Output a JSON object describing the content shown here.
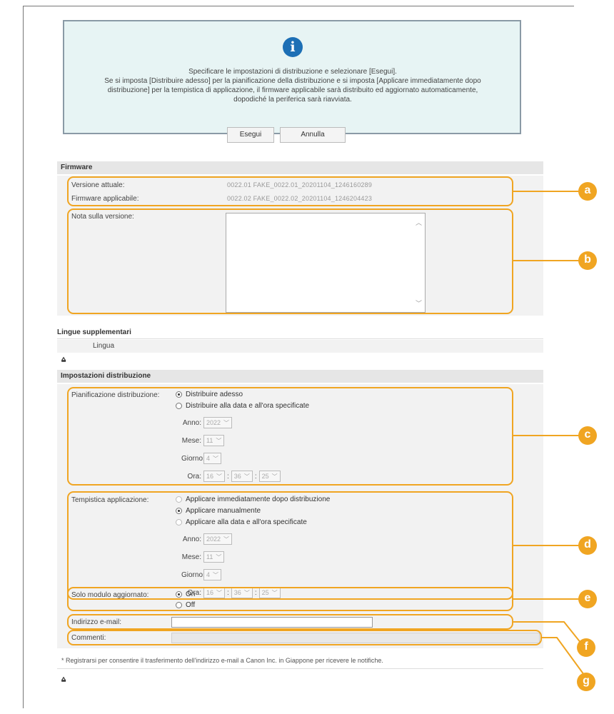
{
  "dialog": {
    "icon": "info-icon",
    "message_line1": "Specificare le impostazioni di distribuzione e selezionare [Esegui].",
    "message_line2": "Se si imposta [Distribuire adesso] per la pianificazione della distribuzione e si imposta [Applicare immediatamente dopo distribuzione] per la tempistica di applicazione, il firmware applicabile sarà distribuito ed aggiornato automaticamente, dopodiché la periferica sarà riavviata.",
    "execute_label": "Esegui",
    "cancel_label": "Annulla"
  },
  "firmware": {
    "heading": "Firmware",
    "current_version_label": "Versione attuale:",
    "current_version_value": "0022.01 FAKE_0022.01_20201104_1246160289",
    "applicable_label": "Firmware applicabile:",
    "applicable_value": "0022.02 FAKE_0022.02_20201104_1246204423",
    "release_note_label": "Nota sulla versione:"
  },
  "languages": {
    "heading": "Lingue supplementari",
    "column_label": "Lingua"
  },
  "distribution": {
    "heading": "Impostazioni distribuzione",
    "schedule_label": "Pianificazione distribuzione:",
    "schedule_options": [
      "Distribuire adesso",
      "Distribuire alla data e all'ora specificate"
    ],
    "timing_label": "Tempistica applicazione:",
    "timing_options": [
      "Applicare immediatamente dopo distribuzione",
      "Applicare manualmente",
      "Applicare alla data e all'ora specificate"
    ],
    "year_label": "Anno:",
    "month_label": "Mese:",
    "day_label": "Giorno:",
    "hour_label": "Ora:",
    "year_value": "2022",
    "month_value": "11",
    "day_value": "4",
    "hour_value": "16",
    "minute_value": "36",
    "second_value": "25",
    "updated_module_label": "Solo modulo aggiornato:",
    "on_label": "On",
    "off_label": "Off",
    "email_label": "Indirizzo e-mail:",
    "comments_label": "Commenti:",
    "note": "* Registrarsi per consentire il trasferimento dell'indirizzo e-mail a Canon Inc. in Giappone per ricevere le notifiche."
  },
  "top_link_glyph": "⩠",
  "callouts": [
    "a",
    "b",
    "c",
    "d",
    "e",
    "f",
    "g"
  ],
  "accent_color": "#f0a522"
}
